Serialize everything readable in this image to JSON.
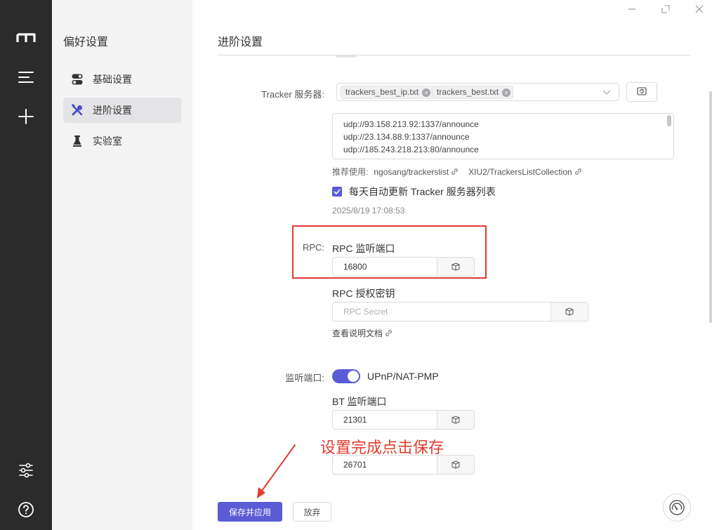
{
  "rail": {
    "icons": [
      "logo-icon",
      "menu-icon",
      "add-icon",
      "preferences-icon",
      "help-icon"
    ]
  },
  "sidebar": {
    "title": "偏好设置",
    "items": [
      {
        "label": "基础设置",
        "icon": "toggle-icon"
      },
      {
        "label": "进阶设置",
        "icon": "tools-icon",
        "active": true
      },
      {
        "label": "实验室",
        "icon": "flask-icon"
      }
    ]
  },
  "main": {
    "title": "进阶设置",
    "tracker": {
      "label": "Tracker 服务器:",
      "tags": [
        "trackers_best_ip.txt",
        "trackers_best.txt"
      ],
      "lines": [
        "udp://93.158.213.92:1337/announce",
        "udp://23.134.88.9:1337/announce",
        "udp://185.243.218.213:80/announce"
      ],
      "recommend_label": "推荐使用:",
      "links": [
        "ngosang/trackerslist",
        "XIU2/TrackersListCollection"
      ],
      "auto_update_label": "每天自动更新 Tracker 服务器列表",
      "auto_update_checked": true,
      "last_updated": "2025/8/19 17:08:53"
    },
    "rpc": {
      "label": "RPC:",
      "port_label": "RPC 监听端口",
      "port_value": "16800",
      "secret_label": "RPC 授权密钥",
      "secret_placeholder": "RPC Secret",
      "doc_link": "查看说明文档"
    },
    "listen": {
      "label": "监听端口:",
      "upnp_label": "UPnP/NAT-PMP",
      "upnp_enabled": true,
      "bt_label": "BT 监听端口",
      "bt_value": "21301",
      "dht_value": "26701"
    },
    "annotation": "设置完成点击保存",
    "save_label": "保存并应用",
    "discard_label": "放弃"
  },
  "colors": {
    "accent": "#5b5bd6",
    "annotation": "#e03c2e",
    "rail": "#2b2b2b",
    "sidebar": "#f4f4f5"
  }
}
